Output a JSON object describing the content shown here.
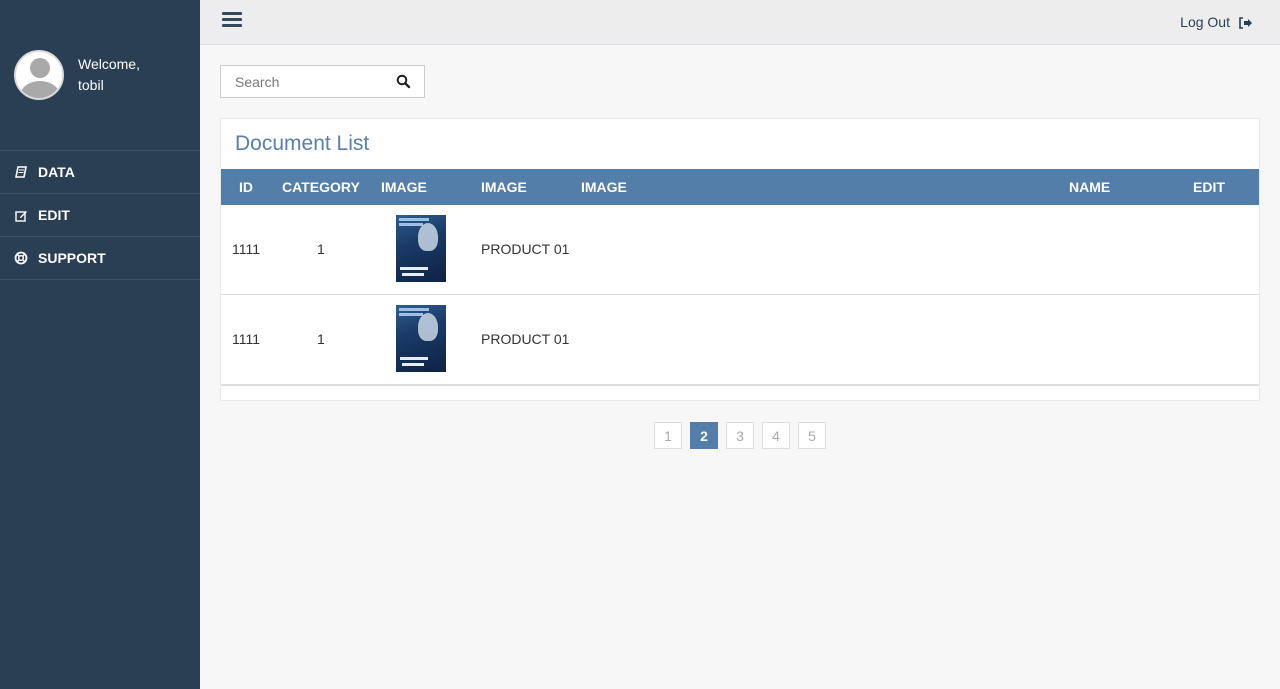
{
  "sidebar": {
    "welcome_line1": "Welcome,",
    "welcome_line2": "tobil",
    "items": [
      {
        "label": "DATA",
        "icon": "book-icon"
      },
      {
        "label": "EDIT",
        "icon": "edit-icon"
      },
      {
        "label": "SUPPORT",
        "icon": "life-ring-icon"
      }
    ]
  },
  "topbar": {
    "logout_label": "Log Out"
  },
  "search": {
    "placeholder": "Search"
  },
  "panel": {
    "title": "Document List",
    "columns": [
      "ID",
      "CATEGORY",
      "IMAGE",
      "IMAGE",
      "IMAGE",
      "NAME",
      "EDIT"
    ],
    "rows": [
      {
        "id": "1111",
        "category": "1",
        "name": "PRODUCT 01"
      },
      {
        "id": "1111",
        "category": "1",
        "name": "PRODUCT 01"
      }
    ]
  },
  "pagination": {
    "pages": [
      "1",
      "2",
      "3",
      "4",
      "5"
    ],
    "active": "2"
  },
  "colors": {
    "sidebar": "#2a3f54",
    "accent": "#527ea9",
    "title": "#5a7fa8"
  }
}
